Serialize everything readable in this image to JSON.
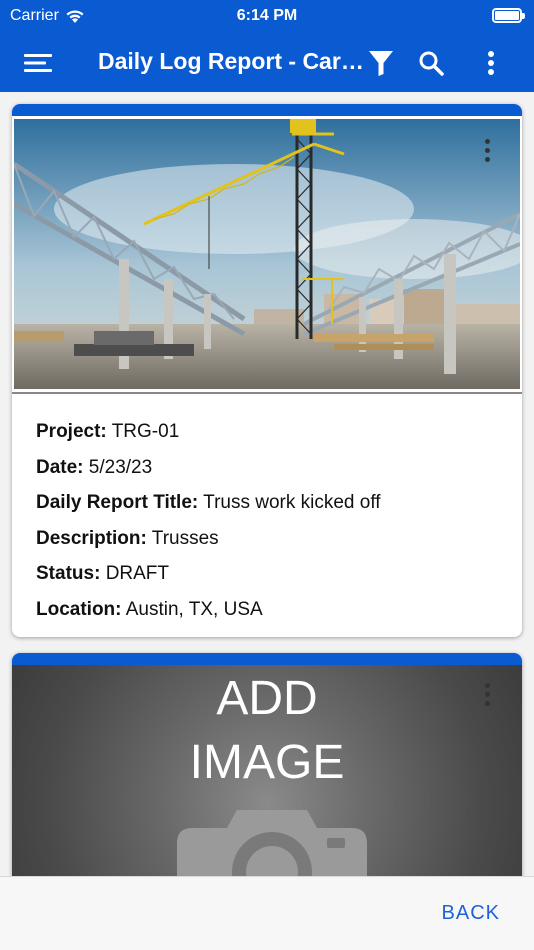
{
  "status_bar": {
    "carrier": "Carrier",
    "time": "6:14 PM"
  },
  "app_bar": {
    "title": "Daily Log Report - Carpenter",
    "icons": [
      "menu-icon",
      "filter-icon",
      "search-icon",
      "more-vertical-icon"
    ]
  },
  "reports": [
    {
      "fields": [
        {
          "label": "Project:",
          "value": "TRG-01"
        },
        {
          "label": "Date:",
          "value": "5/23/23"
        },
        {
          "label": "Daily Report Title:",
          "value": "Truss work kicked off"
        },
        {
          "label": "Description:",
          "value": "Trusses"
        },
        {
          "label": "Status:",
          "value": "DRAFT"
        },
        {
          "label": "Location:",
          "value": "Austin, TX, USA"
        }
      ]
    },
    {
      "placeholder": {
        "line1": "ADD",
        "line2": "IMAGE"
      }
    }
  ],
  "footer": {
    "back_label": "BACK"
  },
  "colors": {
    "primary": "#0a5ad2",
    "back_text": "#1e63d6"
  }
}
